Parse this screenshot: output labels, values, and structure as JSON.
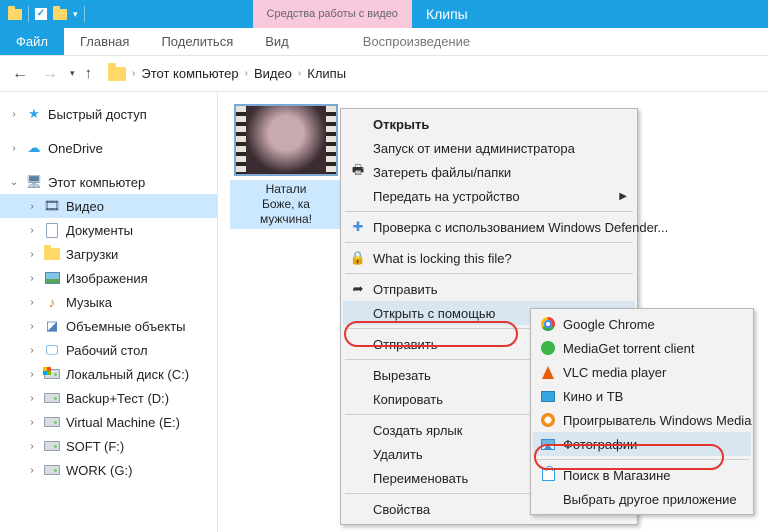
{
  "titlebar": {
    "context_tab": "Средства работы с видео",
    "title": "Клипы"
  },
  "ribbon": {
    "file": "Файл",
    "home": "Главная",
    "share": "Поделиться",
    "view": "Вид",
    "play": "Воспроизведение"
  },
  "breadcrumb": {
    "root": "Этот компьютер",
    "l1": "Видео",
    "l2": "Клипы"
  },
  "sidebar": {
    "quick": "Быстрый доступ",
    "onedrive": "OneDrive",
    "thispc": "Этот компьютер",
    "video": "Видео",
    "docs": "Документы",
    "downloads": "Загрузки",
    "pictures": "Изображения",
    "music": "Музыка",
    "objects3d": "Объемные объекты",
    "desktop": "Рабочий стол",
    "drive_c": "Локальный диск (C:)",
    "drive_d": "Backup+Тест (D:)",
    "drive_e": "Virtual Machine (E:)",
    "drive_f": "SOFT (F:)",
    "drive_g": "WORK (G:)"
  },
  "file": {
    "caption": "Натали\nБоже, ка\nмужчина!"
  },
  "cm1": {
    "open": "Открыть",
    "runas": "Запуск от имени администратора",
    "erase": "Затереть файлы/папки",
    "cast": "Передать на устройство",
    "defender": "Проверка с использованием Windows Defender...",
    "locking": "What is locking this file?",
    "send": "Отправить",
    "openwith": "Открыть с помощью",
    "send2": "Отправить",
    "cut": "Вырезать",
    "copy": "Копировать",
    "shortcut": "Создать ярлык",
    "delete": "Удалить",
    "rename": "Переименовать",
    "properties": "Свойства"
  },
  "cm2": {
    "chrome": "Google Chrome",
    "mediaget": "MediaGet torrent client",
    "vlc": "VLC media player",
    "movies": "Кино и ТВ",
    "wmp": "Проигрыватель Windows Media",
    "photos": "Фотографии",
    "store": "Поиск в Магазине",
    "choose": "Выбрать другое приложение"
  }
}
